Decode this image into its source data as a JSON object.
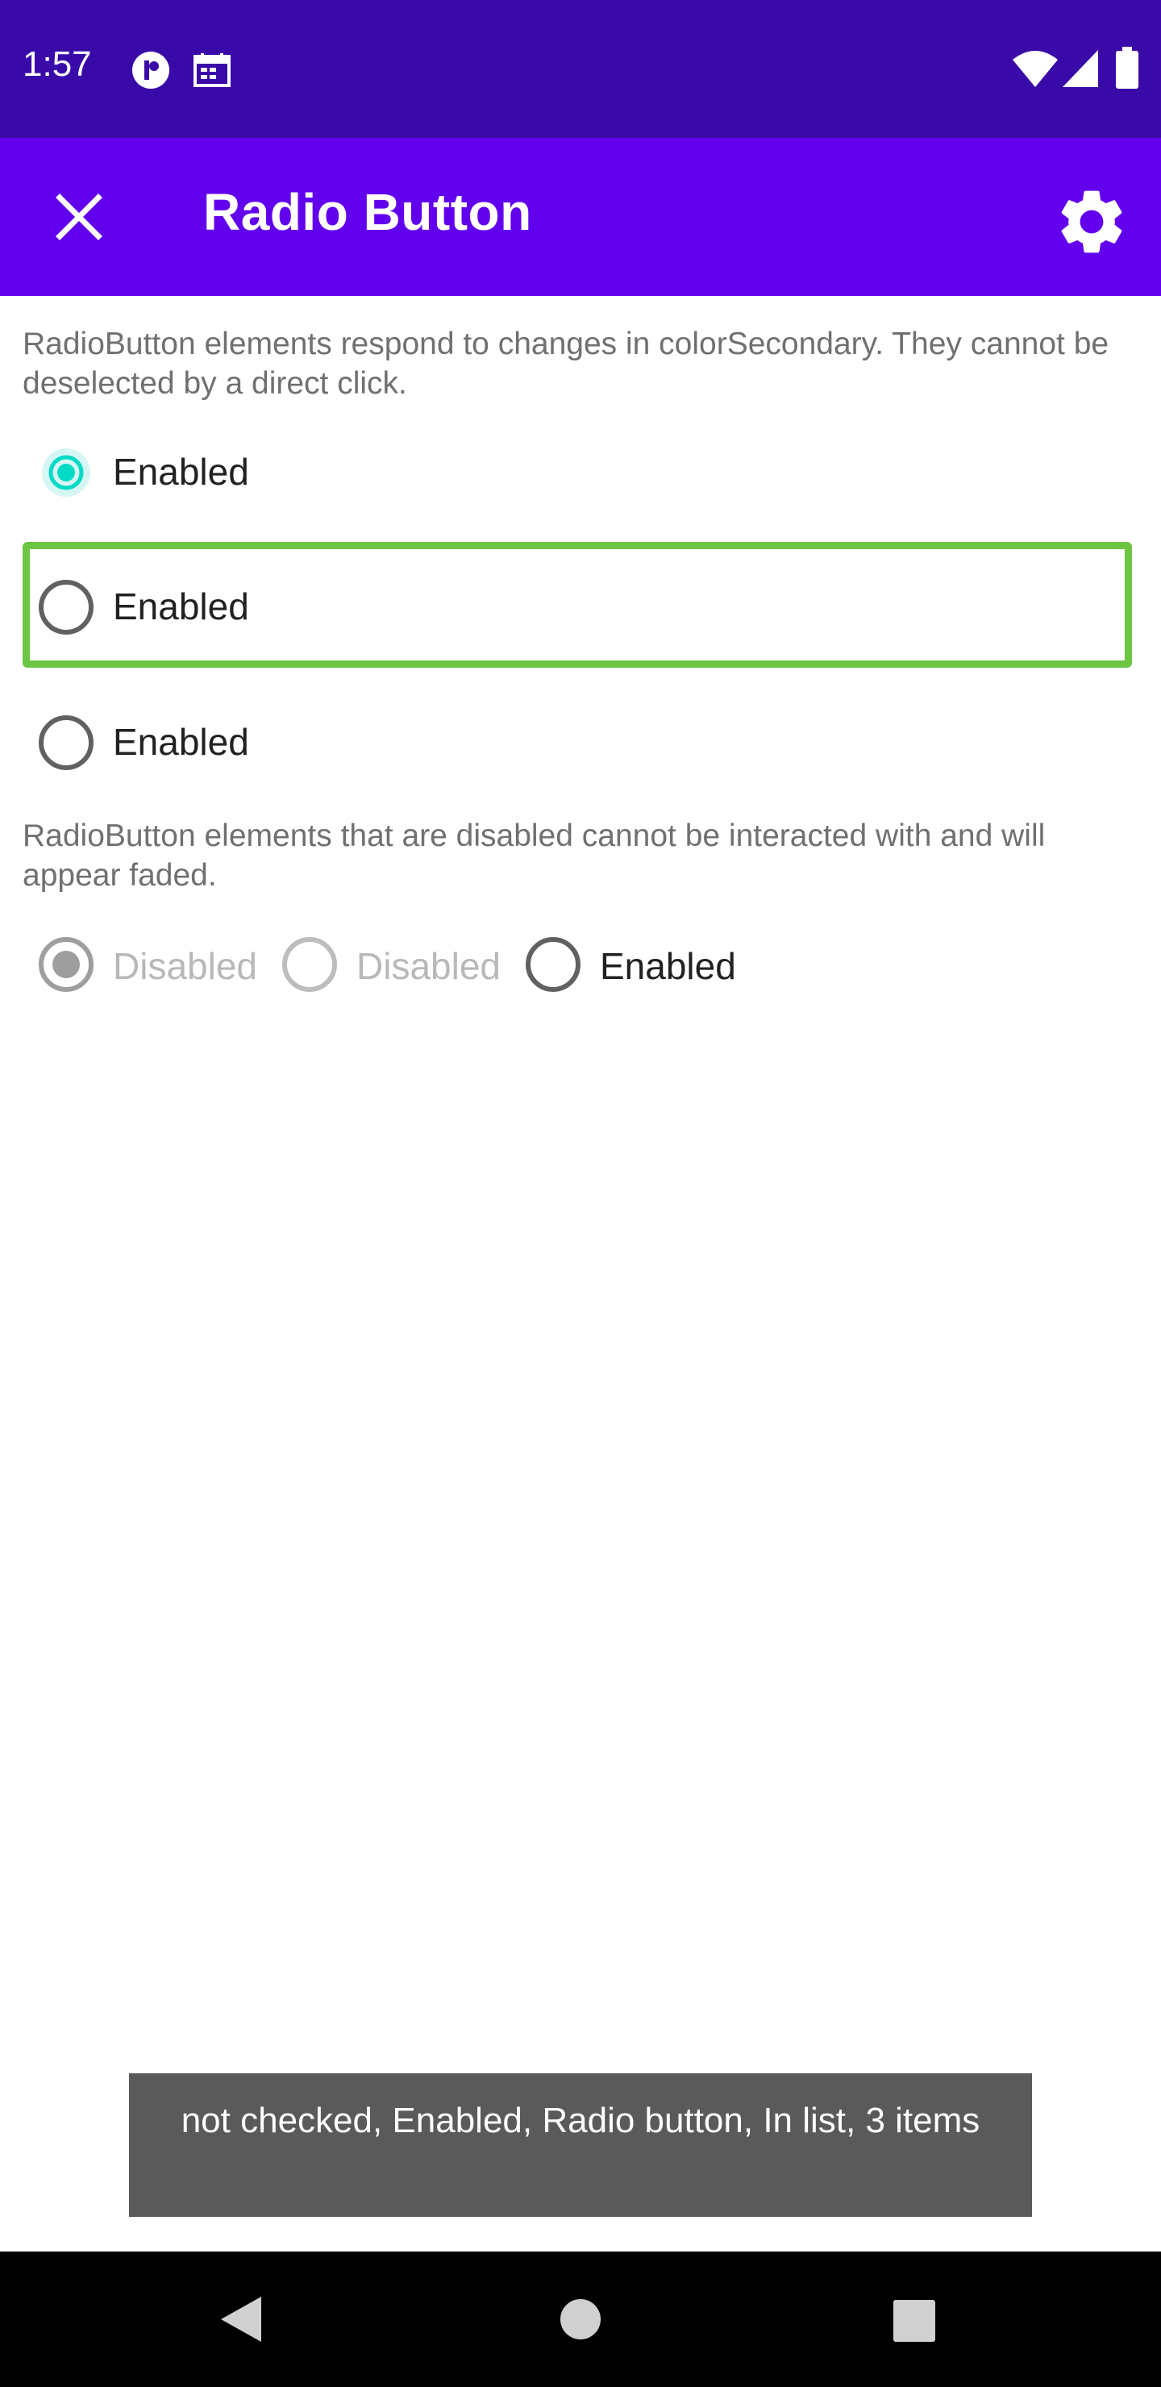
{
  "status_bar": {
    "time": "1:57",
    "icons": [
      "media-icon",
      "calendar-icon",
      "wifi-icon",
      "signal-icon",
      "battery-icon"
    ]
  },
  "app_bar": {
    "title": "Radio Button",
    "close_icon": "close-icon",
    "settings_icon": "gear-icon"
  },
  "colors": {
    "status_bar": "#3a0aa8",
    "app_bar": "#6200ee",
    "accent": "#03dac5",
    "focus_outline": "#6cc644",
    "toast_bg": "#5a5a5a"
  },
  "section1": {
    "description": "RadioButton elements respond to changes in colorSecondary. They cannot be deselected by a direct click.",
    "radios": [
      {
        "label": "Enabled",
        "checked": true
      },
      {
        "label": "Enabled",
        "checked": false,
        "focused": true
      },
      {
        "label": "Enabled",
        "checked": false
      }
    ]
  },
  "section2": {
    "description": "RadioButton elements that are disabled cannot be interacted with and will appear faded.",
    "radios": [
      {
        "label": "Disabled",
        "checked": true,
        "enabled": false
      },
      {
        "label": "Disabled",
        "checked": false,
        "enabled": false
      },
      {
        "label": "Enabled",
        "checked": false,
        "enabled": true
      }
    ]
  },
  "toast": {
    "text": "not checked, Enabled, Radio button, In list, 3 items"
  },
  "nav_bar": {
    "buttons": [
      "back-icon",
      "home-icon",
      "recents-icon"
    ]
  }
}
